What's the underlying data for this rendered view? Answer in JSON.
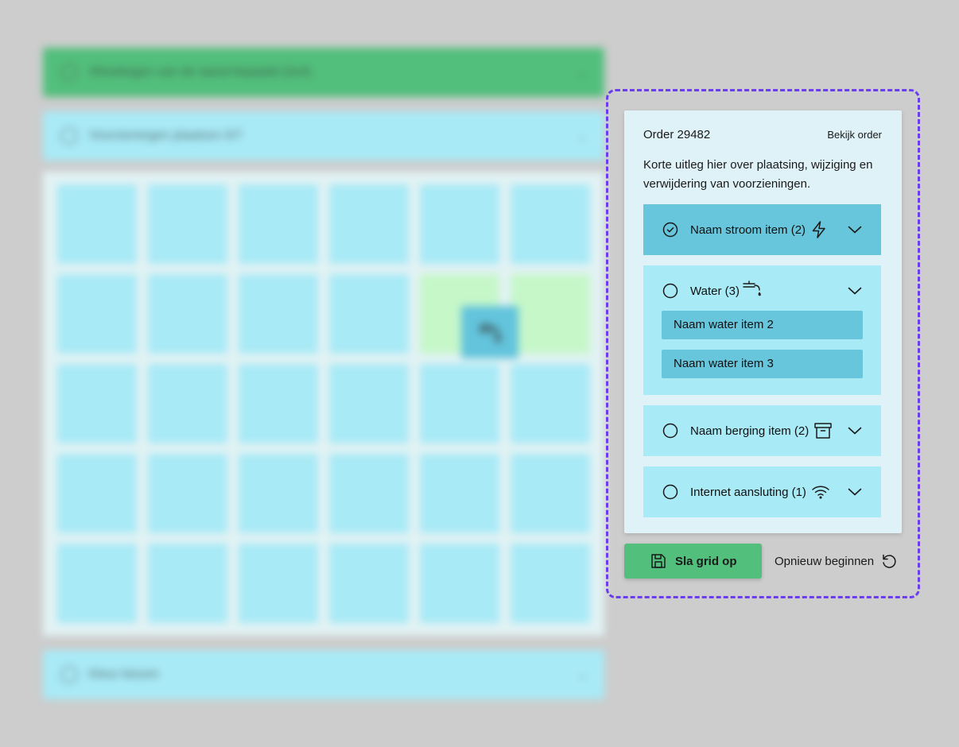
{
  "background": {
    "bar1_text": "Afmetingen van de stand bepaald (3x4)",
    "bar2_text": "Voorzieningen plaatsen 0/7",
    "bar3_text": "Kleur kiezen"
  },
  "panel": {
    "order_title": "Order 29482",
    "order_link": "Bekijk order",
    "intro": "Korte uitleg hier over plaatsing, wijziging en verwijdering van voorzieningen.",
    "items": [
      {
        "label": "Naam stroom item (2)",
        "icon": "bolt-icon",
        "checked": true
      },
      {
        "label": "Water (3)",
        "icon": "tap-icon",
        "checked": false,
        "subitems": [
          "Naam water item 2",
          "Naam water item 3"
        ]
      },
      {
        "label": "Naam berging item (2)",
        "icon": "archive-icon",
        "checked": false
      },
      {
        "label": "Internet aansluting (1)",
        "icon": "wifi-icon",
        "checked": false
      }
    ]
  },
  "actions": {
    "save_label": "Sla grid op",
    "restart_label": "Opnieuw beginnen"
  },
  "colors": {
    "accent_green": "#52bf7c",
    "panel_bg": "#dff2f8",
    "item_bg": "#a8eaf6",
    "item_active": "#67c6dc",
    "focus_outline": "#6c3cf0"
  }
}
